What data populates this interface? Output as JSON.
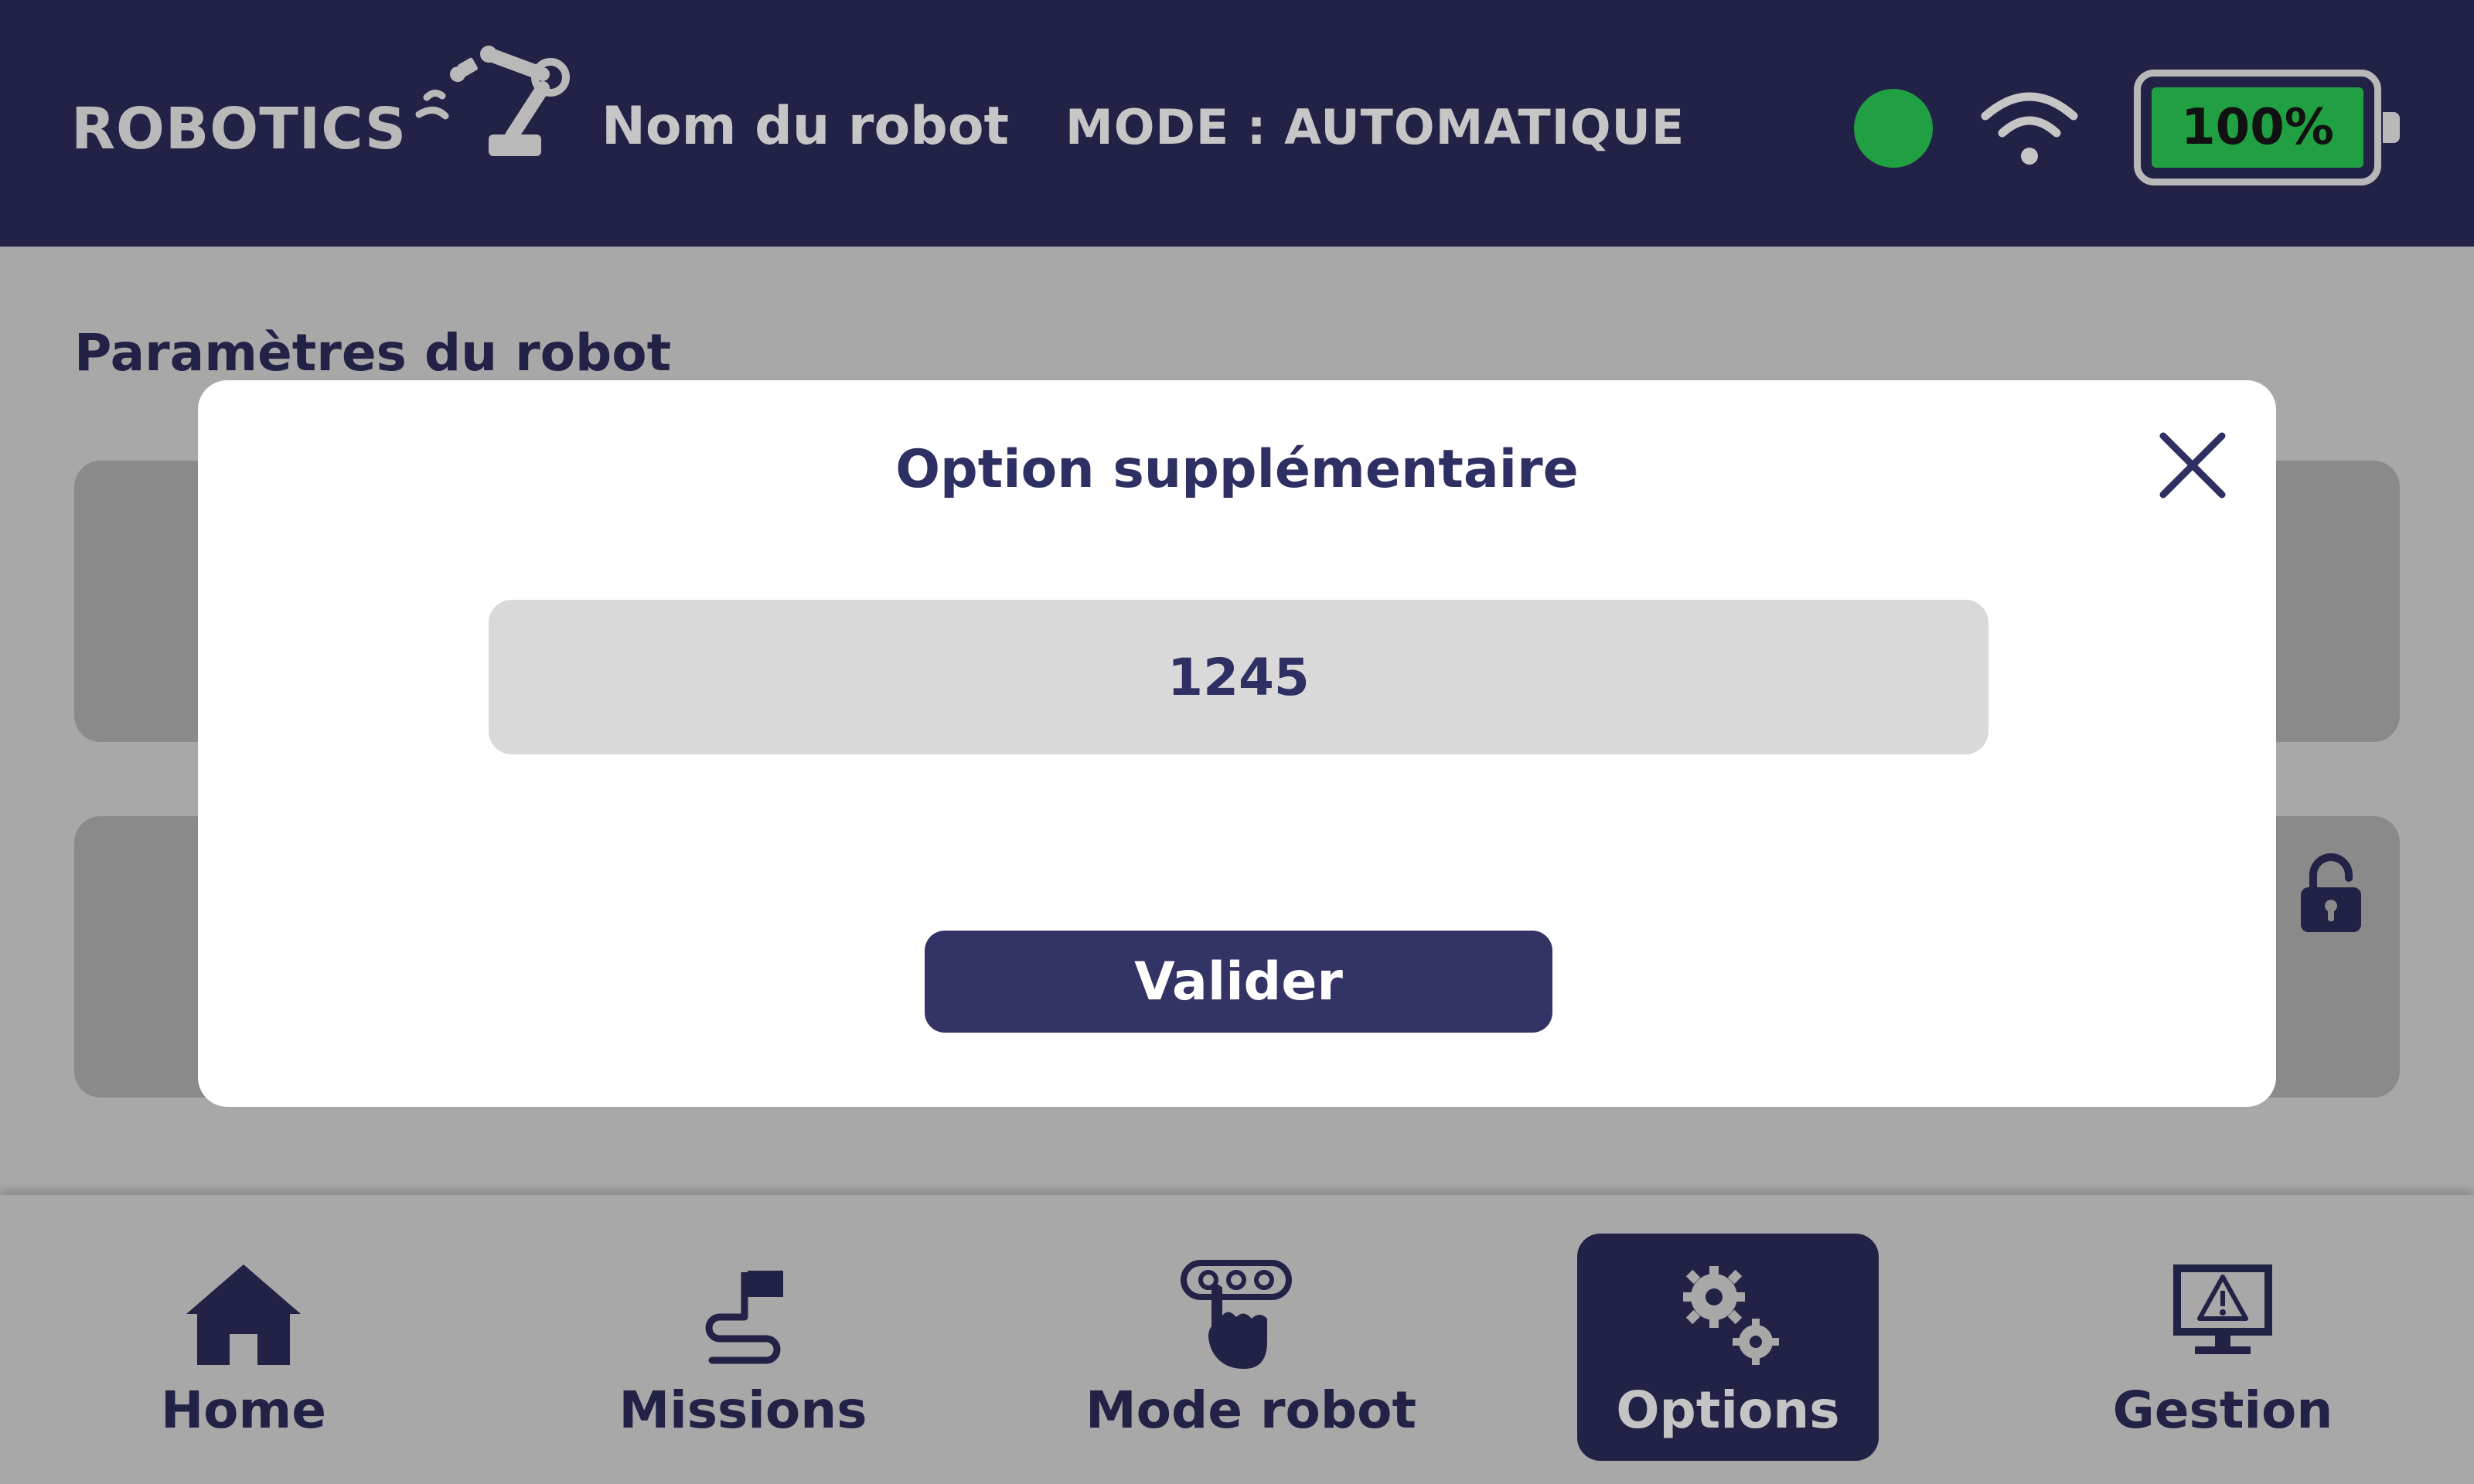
{
  "header": {
    "logo_text": "ROBOTICS",
    "robot_name": "Nom du robot",
    "mode": "MODE : AUTOMATIQUE",
    "status_color": "#20a043",
    "battery": {
      "label": "100%",
      "level": 1.0,
      "color": "#20a043"
    }
  },
  "main": {
    "section_title": "Paramètres du robot"
  },
  "modal": {
    "title": "Option supplémentaire",
    "input_value": "1245",
    "validate_label": "Valider"
  },
  "nav": {
    "items": [
      {
        "label": "Home",
        "icon": "home-icon",
        "active": false
      },
      {
        "label": "Missions",
        "icon": "flag-path-icon",
        "active": false
      },
      {
        "label": "Mode robot",
        "icon": "robot-control-icon",
        "active": false
      },
      {
        "label": "Options",
        "icon": "gears-icon",
        "active": true
      },
      {
        "label": "Gestion",
        "icon": "monitor-warning-icon",
        "active": false
      }
    ]
  },
  "colors": {
    "navy": "#212245",
    "accent": "#333366",
    "green": "#20a043"
  }
}
